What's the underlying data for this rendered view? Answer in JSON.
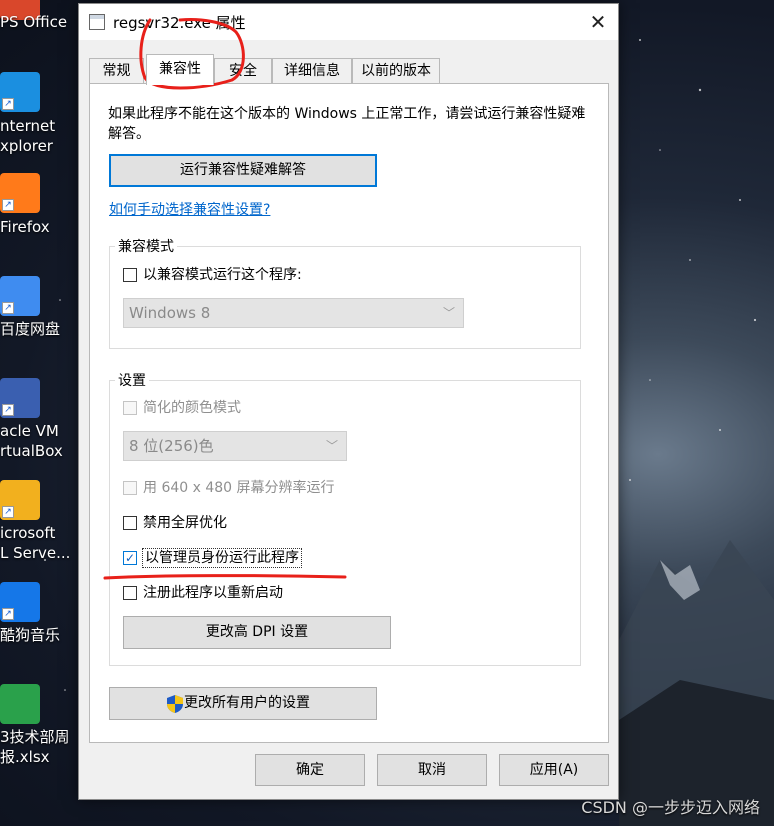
{
  "desktop": {
    "icons": [
      {
        "label": "PS Office",
        "icon": "wps-office-icon"
      },
      {
        "label": "nternet\nxplorer",
        "icon": "internet-explorer-icon"
      },
      {
        "label": "Firefox",
        "icon": "firefox-icon"
      },
      {
        "label": "百度网盘",
        "icon": "baidu-netdisk-icon"
      },
      {
        "label": "acle VM\nrtualBox",
        "icon": "virtualbox-icon"
      },
      {
        "label": "icrosoft\nL Serve...",
        "icon": "sql-server-icon"
      },
      {
        "label": "酷狗音乐",
        "icon": "kugou-music-icon"
      },
      {
        "label": "3技术部周\n报.xlsx",
        "icon": "excel-file-icon"
      }
    ],
    "watermark": "CSDN @一步步迈入网络"
  },
  "window": {
    "title": "regsvr32.exe 属性",
    "close_label": "✕",
    "tabs": [
      {
        "label": "常规",
        "active": false
      },
      {
        "label": "兼容性",
        "active": true
      },
      {
        "label": "安全",
        "active": false
      },
      {
        "label": "详细信息",
        "active": false
      },
      {
        "label": "以前的版本",
        "active": false
      }
    ],
    "intro_text": "如果此程序不能在这个版本的 Windows 上正常工作，请尝试运行兼容性疑难解答。",
    "troubleshoot_button": "运行兼容性疑难解答",
    "manual_link": "如何手动选择兼容性设置?",
    "compat_mode": {
      "group_label": "兼容模式",
      "checkbox_label": "以兼容模式运行这个程序:",
      "checked": false,
      "os_select_value": "Windows 8"
    },
    "settings": {
      "group_label": "设置",
      "reduced_color": {
        "label": "简化的颜色模式",
        "checked": false,
        "enabled": false
      },
      "color_select_value": "8 位(256)色",
      "run_640": {
        "label": "用 640 x 480 屏幕分辨率运行",
        "checked": false,
        "enabled": false
      },
      "disable_fullscreen": {
        "label": "禁用全屏优化",
        "checked": false,
        "enabled": true
      },
      "run_as_admin": {
        "label": "以管理员身份运行此程序",
        "checked": true,
        "enabled": true
      },
      "register_restart": {
        "label": "注册此程序以重新启动",
        "checked": false,
        "enabled": true
      },
      "dpi_button": "更改高 DPI 设置"
    },
    "all_users_button": "更改所有用户的设置",
    "footer": {
      "ok": "确定",
      "cancel": "取消",
      "apply": "应用(A)"
    }
  },
  "colors": {
    "accent": "#0078d7",
    "link": "#0066cc",
    "annotation": "#e8201a"
  }
}
